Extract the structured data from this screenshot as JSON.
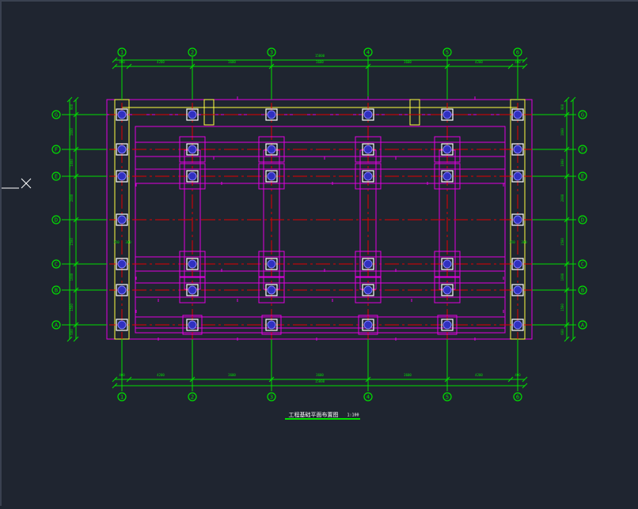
{
  "drawing": {
    "title": "工程基础平面布置图",
    "title_scale": "1:100",
    "col_labels": [
      "1",
      "2",
      "3",
      "4",
      "5",
      "6"
    ],
    "row_labels": [
      "G",
      "F",
      "E",
      "D",
      "C",
      "B",
      "A"
    ],
    "top_total": "15800",
    "top_spans": [
      "400",
      "4200",
      "3600",
      "3600",
      "3600",
      "4200",
      "400"
    ],
    "bottom_total": "15800",
    "bottom_spans": [
      "400",
      "4200",
      "3600",
      "3600",
      "3600",
      "4200",
      "400"
    ],
    "left_spans": [
      "900",
      "1600",
      "1000",
      "2000",
      "1500",
      "1000",
      "1500",
      "600"
    ],
    "right_spans": [
      "900",
      "1600",
      "1000",
      "2000",
      "1500",
      "1000",
      "1500",
      "600"
    ],
    "small_dims": [
      "250",
      "300",
      "250",
      "300"
    ],
    "colors": {
      "background": "#1f2530",
      "dimension": "#00e000",
      "wall": "#e000e0",
      "axis": "#e00000",
      "column": "#ffffff",
      "slab_edge": "#ffff40",
      "bubble": "#00e000"
    }
  },
  "ucs_icon": "ucs-cross-icon"
}
